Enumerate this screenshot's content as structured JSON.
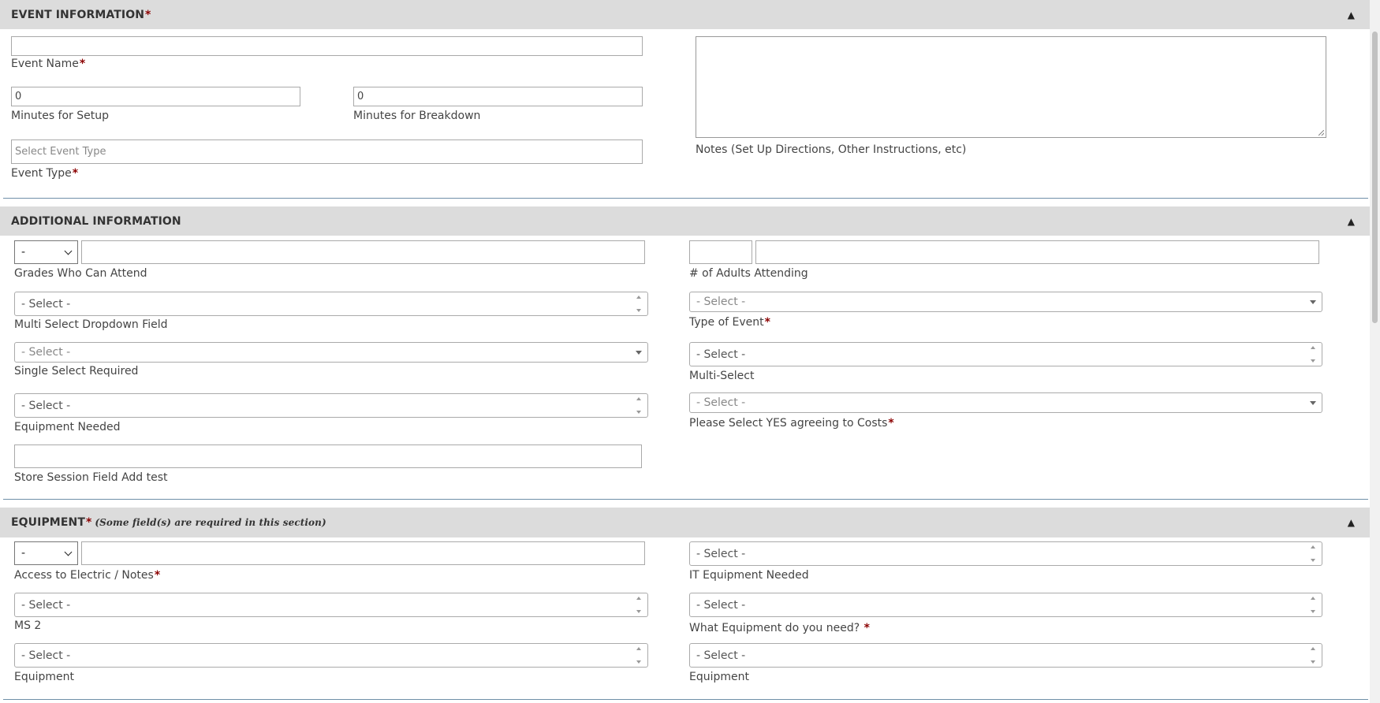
{
  "sections": {
    "event": {
      "title": "EVENT INFORMATION",
      "req": "*",
      "fields": {
        "event_name": {
          "label": "Event Name",
          "req": "*",
          "value": ""
        },
        "minutes_setup": {
          "label": "Minutes for Setup",
          "value": "0"
        },
        "minutes_breakdown": {
          "label": "Minutes for Breakdown",
          "value": "0"
        },
        "event_type": {
          "label": "Event Type",
          "req": "*",
          "placeholder": "Select Event Type"
        },
        "notes": {
          "label": "Notes (Set Up Directions, Other Instructions, etc)",
          "value": ""
        }
      }
    },
    "additional": {
      "title": "ADDITIONAL INFORMATION",
      "fields": {
        "grades": {
          "label": "Grades Who Can Attend",
          "select_value": "-"
        },
        "adults": {
          "label": "# of Adults Attending"
        },
        "multi_dropdown": {
          "label": "Multi Select Dropdown Field",
          "value": "- Select -"
        },
        "type_of_event": {
          "label": "Type of Event",
          "req": "*",
          "value": "- Select -"
        },
        "single_required": {
          "label": "Single Select Required",
          "value": "- Select -"
        },
        "multi_select": {
          "label": "Multi-Select",
          "value": "- Select -"
        },
        "equipment_needed": {
          "label": "Equipment Needed",
          "value": "- Select -"
        },
        "agree_costs": {
          "label": "Please Select YES agreeing to Costs",
          "req": "*",
          "value": "- Select -"
        },
        "store_session": {
          "label": "Store Session Field Add test",
          "value": ""
        }
      }
    },
    "equipment": {
      "title": "EQUIPMENT",
      "req": "*",
      "note": "(Some field(s) are required in this section)",
      "fields": {
        "access_electric": {
          "label": "Access to Electric / Notes",
          "req": "*",
          "select_value": "-"
        },
        "it_equipment": {
          "label": "IT Equipment Needed",
          "value": "- Select -"
        },
        "ms2": {
          "label": "MS 2",
          "value": "- Select -"
        },
        "what_equipment": {
          "label": "What Equipment do you need?",
          "req": "*",
          "value": "- Select -"
        },
        "equipment_left": {
          "label": "Equipment",
          "value": "- Select -"
        },
        "equipment_right": {
          "label": "Equipment",
          "value": "- Select -"
        }
      }
    }
  },
  "icons": {
    "collapse": "caret-up-icon"
  }
}
